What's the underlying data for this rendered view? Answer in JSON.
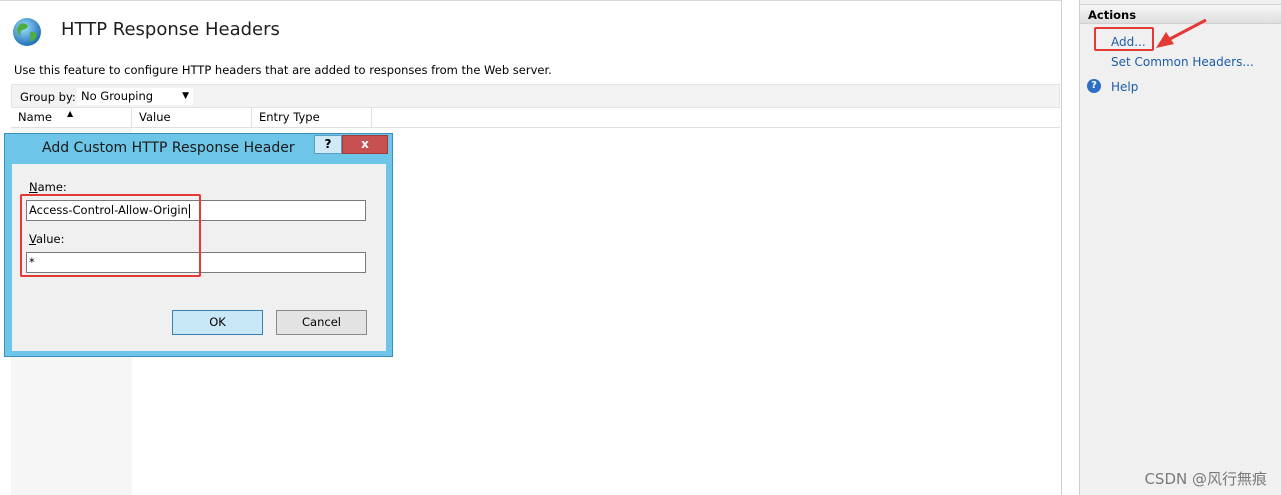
{
  "feature": {
    "title": "HTTP Response Headers",
    "description": "Use this feature to configure HTTP headers that are added to responses from the Web server.",
    "icon": "globe-icon"
  },
  "toolbar": {
    "group_by_label": "Group by:",
    "group_by_value": "No Grouping"
  },
  "columns": [
    "Name",
    "Value",
    "Entry Type"
  ],
  "dialog": {
    "title": "Add Custom HTTP Response Header",
    "help_label": "?",
    "close_label": "x",
    "name_label_key": "N",
    "name_label_rest": "ame:",
    "name_value": "Access-Control-Allow-Origin",
    "value_label_key": "V",
    "value_label_rest": "alue:",
    "value_value": "*",
    "ok_label": "OK",
    "cancel_label": "Cancel"
  },
  "actions": {
    "title": "Actions",
    "add_label": "Add...",
    "set_common_label": "Set Common Headers...",
    "help_label": "Help"
  },
  "watermark": "CSDN @风行無痕",
  "colors": {
    "dialog_frame": "#6dc6e7",
    "close_button": "#c75050",
    "link": "#1c5ca8",
    "annotation_red": "#e53935"
  }
}
